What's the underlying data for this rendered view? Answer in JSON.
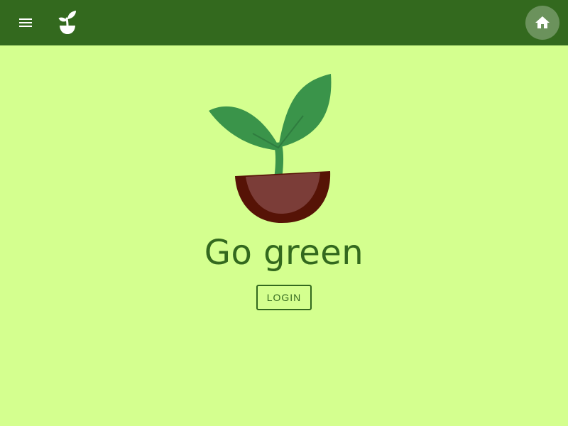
{
  "header": {
    "menu_icon": "menu-icon",
    "logo_icon": "sprout-icon",
    "home_icon": "home-icon",
    "background_color": "#33691e"
  },
  "main": {
    "illustration": "sprout-in-pot-icon",
    "title": "Go green",
    "login_label": "LOGIN",
    "background_color": "#d4ff8f",
    "accent_color": "#33691e"
  }
}
